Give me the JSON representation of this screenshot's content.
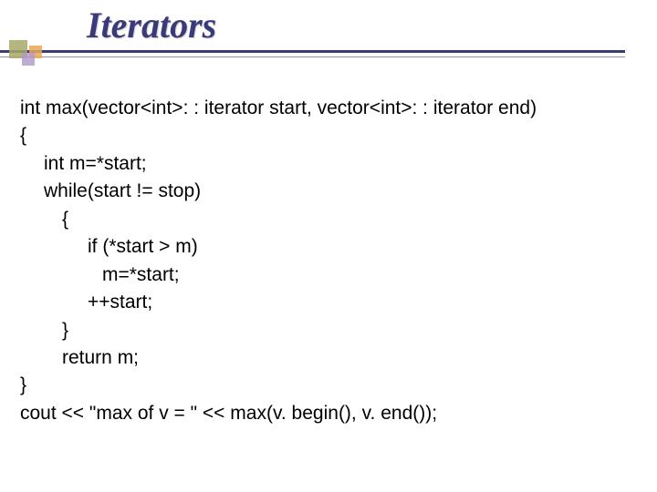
{
  "title": "Iterators",
  "code": {
    "l1": "int max(vector<int>: : iterator start, vector<int>: : iterator end)",
    "l2": "{",
    "l3": "int m=*start;",
    "l4": "while(start != stop)",
    "l5": "{",
    "l6": "if (*start > m)",
    "l7": "m=*start;",
    "l8": "++start;",
    "l9": "}",
    "l10": "return m;",
    "l11": "}",
    "l12": "cout << \"max of v = \" << max(v. begin(), v. end());"
  }
}
